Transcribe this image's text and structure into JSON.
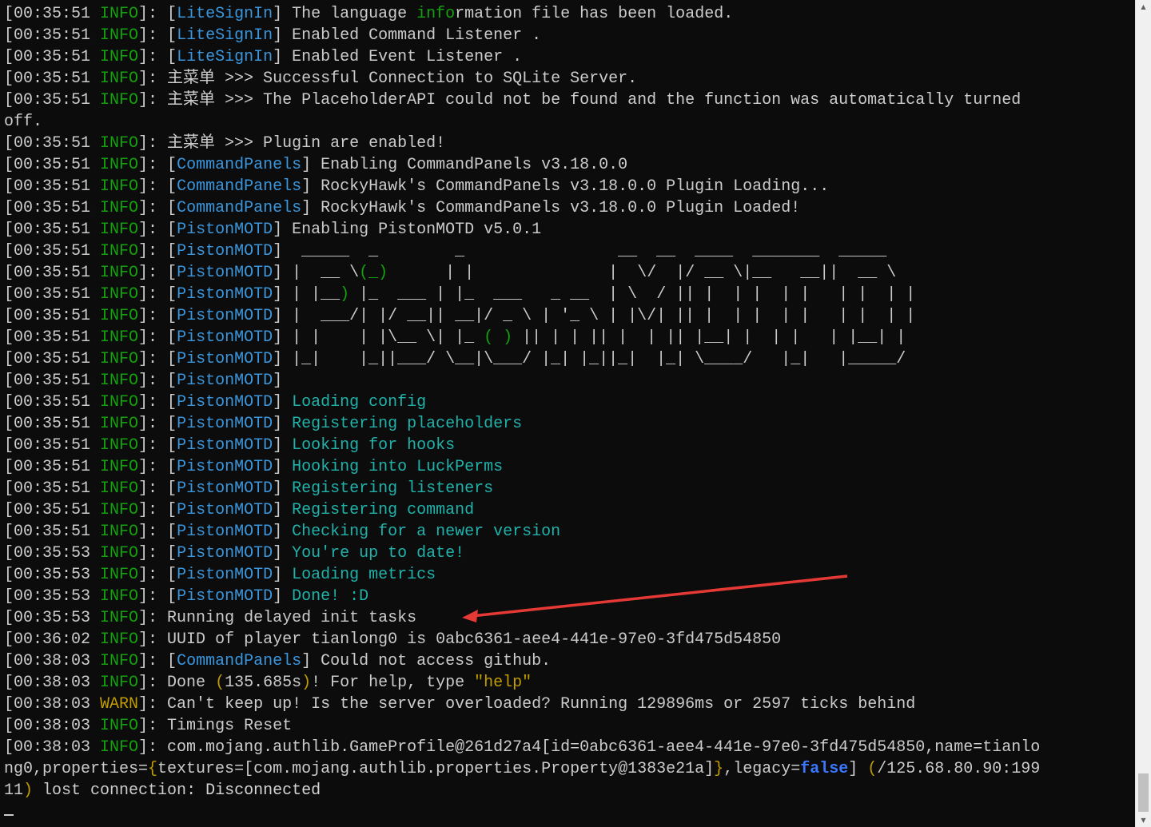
{
  "console": {
    "lines": [
      [
        [
          "[00:35:51 ",
          ""
        ],
        [
          "INFO",
          "info"
        ],
        [
          "]: [",
          ""
        ],
        [
          "LiteSignIn",
          "cyan"
        ],
        [
          "] The language ",
          ""
        ],
        [
          "info",
          "info"
        ],
        [
          "rmation file has been loaded.",
          ""
        ]
      ],
      [
        [
          "[00:35:51 ",
          ""
        ],
        [
          "INFO",
          "info"
        ],
        [
          "]: [",
          ""
        ],
        [
          "LiteSignIn",
          "cyan"
        ],
        [
          "] Enabled Command Listener .",
          ""
        ]
      ],
      [
        [
          "[00:35:51 ",
          ""
        ],
        [
          "INFO",
          "info"
        ],
        [
          "]: [",
          ""
        ],
        [
          "LiteSignIn",
          "cyan"
        ],
        [
          "] Enabled Event Listener .",
          ""
        ]
      ],
      [
        [
          "[00:35:51 ",
          ""
        ],
        [
          "INFO",
          "info"
        ],
        [
          "]: 主菜单 >>> Successful Connection to SQLite Server.",
          ""
        ]
      ],
      [
        [
          "[00:35:51 ",
          ""
        ],
        [
          "INFO",
          "info"
        ],
        [
          "]: 主菜单 >>> The PlaceholderAPI could not be found and the function was automatically turned",
          ""
        ]
      ],
      [
        [
          "off.",
          ""
        ]
      ],
      [
        [
          "[00:35:51 ",
          ""
        ],
        [
          "INFO",
          "info"
        ],
        [
          "]: 主菜单 >>> Plugin are enabled!",
          ""
        ]
      ],
      [
        [
          "[00:35:51 ",
          ""
        ],
        [
          "INFO",
          "info"
        ],
        [
          "]: [",
          ""
        ],
        [
          "CommandPanels",
          "cyan"
        ],
        [
          "] Enabling CommandPanels v3.18.0.0",
          ""
        ]
      ],
      [
        [
          "[00:35:51 ",
          ""
        ],
        [
          "INFO",
          "info"
        ],
        [
          "]: [",
          ""
        ],
        [
          "CommandPanels",
          "cyan"
        ],
        [
          "] RockyHawk's CommandPanels v3.18.0.0 Plugin Loading...",
          ""
        ]
      ],
      [
        [
          "[00:35:51 ",
          ""
        ],
        [
          "INFO",
          "info"
        ],
        [
          "]: [",
          ""
        ],
        [
          "CommandPanels",
          "cyan"
        ],
        [
          "] RockyHawk's CommandPanels v3.18.0.0 Plugin Loaded!",
          ""
        ]
      ],
      [
        [
          "[00:35:51 ",
          ""
        ],
        [
          "INFO",
          "info"
        ],
        [
          "]: [",
          ""
        ],
        [
          "PistonMOTD",
          "cyan"
        ],
        [
          "] Enabling PistonMOTD v5.0.1",
          ""
        ]
      ],
      [
        [
          "[00:35:51 ",
          ""
        ],
        [
          "INFO",
          "info"
        ],
        [
          "]: [",
          ""
        ],
        [
          "PistonMOTD",
          "cyan"
        ],
        [
          "]  _____  _        _                __  __  ____  _______  _____",
          ""
        ]
      ],
      [
        [
          "[00:35:51 ",
          ""
        ],
        [
          "INFO",
          "info"
        ],
        [
          "]: [",
          ""
        ],
        [
          "PistonMOTD",
          "cyan"
        ],
        [
          "] |  __ \\",
          "ascii"
        ],
        [
          "(_)",
          "asciigreen"
        ],
        [
          "      | |              |  \\/  |/ __ \\|__   __||  __ \\",
          ""
        ]
      ],
      [
        [
          "[00:35:51 ",
          ""
        ],
        [
          "INFO",
          "info"
        ],
        [
          "]: [",
          ""
        ],
        [
          "PistonMOTD",
          "cyan"
        ],
        [
          "] | |__",
          ""
        ],
        [
          ")",
          "asciigreen"
        ],
        [
          " |_  ___ | |_  ___   _ __  | \\  / || |  | |  | |   | |  | |",
          ""
        ]
      ],
      [
        [
          "[00:35:51 ",
          ""
        ],
        [
          "INFO",
          "info"
        ],
        [
          "]: [",
          ""
        ],
        [
          "PistonMOTD",
          "cyan"
        ],
        [
          "] |  ___/| |/ __|| __|/ _ \\ | '_ \\ | |\\/| || |  | |  | |   | |  | |",
          ""
        ]
      ],
      [
        [
          "[00:35:51 ",
          ""
        ],
        [
          "INFO",
          "info"
        ],
        [
          "]: [",
          ""
        ],
        [
          "PistonMOTD",
          "cyan"
        ],
        [
          "] | |    | |\\__ \\| |_ ",
          ""
        ],
        [
          "( )",
          "asciigreen"
        ],
        [
          " || | | || |  | || |__| |  | |   | |__| |",
          ""
        ]
      ],
      [
        [
          "[00:35:51 ",
          ""
        ],
        [
          "INFO",
          "info"
        ],
        [
          "]: [",
          ""
        ],
        [
          "PistonMOTD",
          "cyan"
        ],
        [
          "] |_|    |_||___/ \\__|\\___/ |_| |_||_|  |_| \\____/   |_|   |_____/",
          ""
        ]
      ],
      [
        [
          "[00:35:51 ",
          ""
        ],
        [
          "INFO",
          "info"
        ],
        [
          "]: [",
          ""
        ],
        [
          "PistonMOTD",
          "cyan"
        ],
        [
          "]",
          ""
        ]
      ],
      [
        [
          "[00:35:51 ",
          ""
        ],
        [
          "INFO",
          "info"
        ],
        [
          "]: [",
          ""
        ],
        [
          "PistonMOTD",
          "cyan"
        ],
        [
          "] ",
          ""
        ],
        [
          "Loading config",
          "teal"
        ]
      ],
      [
        [
          "[00:35:51 ",
          ""
        ],
        [
          "INFO",
          "info"
        ],
        [
          "]: [",
          ""
        ],
        [
          "PistonMOTD",
          "cyan"
        ],
        [
          "] ",
          ""
        ],
        [
          "Registering placeholders",
          "teal"
        ]
      ],
      [
        [
          "[00:35:51 ",
          ""
        ],
        [
          "INFO",
          "info"
        ],
        [
          "]: [",
          ""
        ],
        [
          "PistonMOTD",
          "cyan"
        ],
        [
          "] ",
          ""
        ],
        [
          "Looking for hooks",
          "teal"
        ]
      ],
      [
        [
          "[00:35:51 ",
          ""
        ],
        [
          "INFO",
          "info"
        ],
        [
          "]: [",
          ""
        ],
        [
          "PistonMOTD",
          "cyan"
        ],
        [
          "] ",
          ""
        ],
        [
          "Hooking into LuckPerms",
          "teal"
        ]
      ],
      [
        [
          "[00:35:51 ",
          ""
        ],
        [
          "INFO",
          "info"
        ],
        [
          "]: [",
          ""
        ],
        [
          "PistonMOTD",
          "cyan"
        ],
        [
          "] ",
          ""
        ],
        [
          "Registering listeners",
          "teal"
        ]
      ],
      [
        [
          "[00:35:51 ",
          ""
        ],
        [
          "INFO",
          "info"
        ],
        [
          "]: [",
          ""
        ],
        [
          "PistonMOTD",
          "cyan"
        ],
        [
          "] ",
          ""
        ],
        [
          "Registering command",
          "teal"
        ]
      ],
      [
        [
          "[00:35:51 ",
          ""
        ],
        [
          "INFO",
          "info"
        ],
        [
          "]: [",
          ""
        ],
        [
          "PistonMOTD",
          "cyan"
        ],
        [
          "] ",
          ""
        ],
        [
          "Checking for a newer version",
          "teal"
        ]
      ],
      [
        [
          "[00:35:53 ",
          ""
        ],
        [
          "INFO",
          "info"
        ],
        [
          "]: [",
          ""
        ],
        [
          "PistonMOTD",
          "cyan"
        ],
        [
          "] ",
          ""
        ],
        [
          "You're up to date!",
          "teal"
        ]
      ],
      [
        [
          "[00:35:53 ",
          ""
        ],
        [
          "INFO",
          "info"
        ],
        [
          "]: [",
          ""
        ],
        [
          "PistonMOTD",
          "cyan"
        ],
        [
          "] ",
          ""
        ],
        [
          "Loading metrics",
          "teal"
        ]
      ],
      [
        [
          "[00:35:53 ",
          ""
        ],
        [
          "INFO",
          "info"
        ],
        [
          "]: [",
          ""
        ],
        [
          "PistonMOTD",
          "cyan"
        ],
        [
          "] ",
          ""
        ],
        [
          "Done! :D",
          "teal"
        ]
      ],
      [
        [
          "[00:35:53 ",
          ""
        ],
        [
          "INFO",
          "info"
        ],
        [
          "]: Running delayed init tasks",
          ""
        ]
      ],
      [
        [
          "[00:36:02 ",
          ""
        ],
        [
          "INFO",
          "info"
        ],
        [
          "]: UUID of player tianlong0 is 0abc6361-aee4-441e-97e0-3fd475d54850",
          ""
        ]
      ],
      [
        [
          "[00:38:03 ",
          ""
        ],
        [
          "INFO",
          "info"
        ],
        [
          "]: [",
          ""
        ],
        [
          "CommandPanels",
          "cyan"
        ],
        [
          "] Could not access github.",
          ""
        ]
      ],
      [
        [
          "[00:38:03 ",
          ""
        ],
        [
          "INFO",
          "info"
        ],
        [
          "]: Done ",
          ""
        ],
        [
          "(",
          "gold"
        ],
        [
          "135.685s",
          ""
        ],
        [
          ")",
          "gold"
        ],
        [
          "! For help, type ",
          ""
        ],
        [
          "\"help\"",
          "gold"
        ]
      ],
      [
        [
          "[00:38:03 ",
          ""
        ],
        [
          "WARN",
          "warn"
        ],
        [
          "]: Can't keep up! Is the server overloaded? Running 129896ms or 2597 ticks behind",
          ""
        ]
      ],
      [
        [
          "[00:38:03 ",
          ""
        ],
        [
          "INFO",
          "info"
        ],
        [
          "]: Timings Reset",
          ""
        ]
      ],
      [
        [
          "[00:38:03 ",
          ""
        ],
        [
          "INFO",
          "info"
        ],
        [
          "]: com.mojang.authlib.GameProfile@261d27a4[id=0abc6361-aee4-441e-97e0-3fd475d54850,name=tianlo",
          ""
        ]
      ],
      [
        [
          "ng0,properties=",
          ""
        ],
        [
          "{",
          "gold"
        ],
        [
          "textures=[com.mojang.authlib.properties.Property@1383e21a]",
          ""
        ],
        [
          "}",
          "gold"
        ],
        [
          ",legacy=",
          ""
        ],
        [
          "false",
          "true"
        ],
        [
          "] ",
          ""
        ],
        [
          "(",
          "gold"
        ],
        [
          "/125.68.80.90:199",
          ""
        ]
      ],
      [
        [
          "11",
          ""
        ],
        [
          ")",
          "gold"
        ],
        [
          " lost connection: ",
          ""
        ],
        [
          "Disconnected",
          "white"
        ]
      ]
    ]
  },
  "colors": {
    "background": "#0c0c0c",
    "text": "#cccccc",
    "info": "#13a10e",
    "warn": "#c19c00",
    "plugin_tag": "#3a96dd",
    "highlight": "#20b2aa",
    "annotation_arrow": "#e53935"
  },
  "scrollbar": {
    "up_icon": "triangle-up-icon",
    "down_icon": "triangle-down-icon",
    "up_glyph": "▲",
    "down_glyph": "▼"
  }
}
